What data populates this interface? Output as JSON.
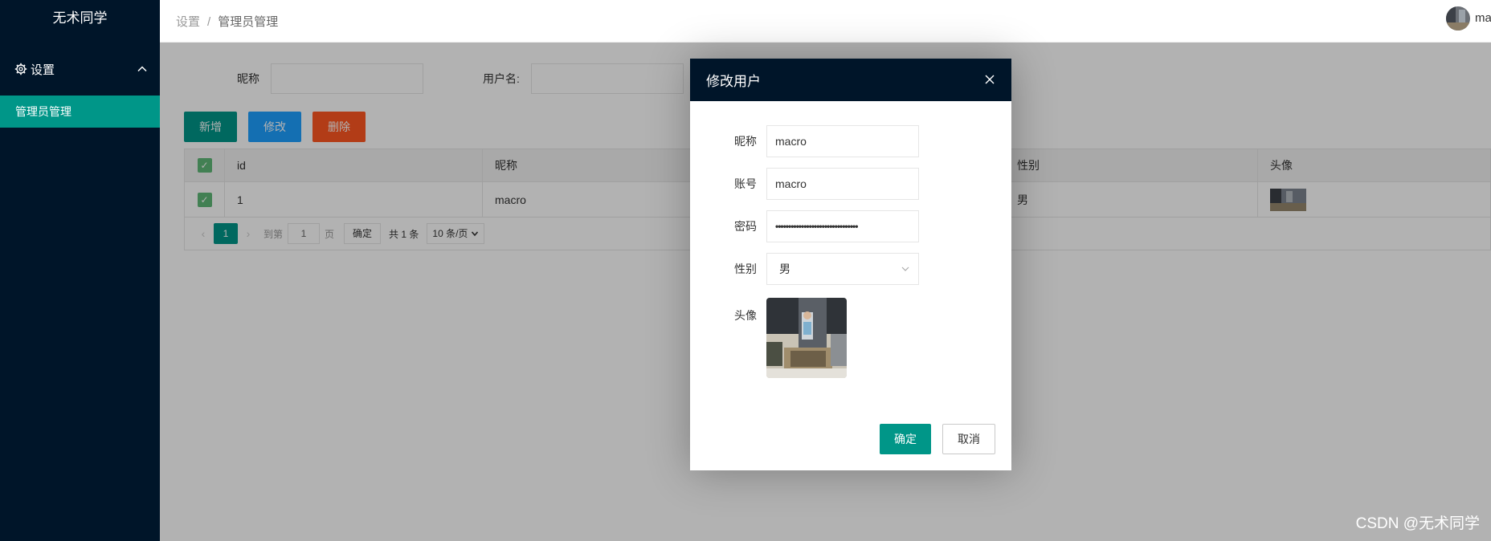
{
  "sidebar": {
    "brand": "无术同学",
    "group_label": "设置",
    "item_label": "管理员管理"
  },
  "header": {
    "crumb_root": "设置",
    "crumb_sep": "/",
    "crumb_current": "管理员管理",
    "user_name": "ma"
  },
  "search": {
    "nickname_label": "昵称",
    "username_label": "用户名:"
  },
  "toolbar": {
    "add_label": "新增",
    "edit_label": "修改",
    "delete_label": "删除"
  },
  "table": {
    "columns": [
      "id",
      "昵称",
      "性别",
      "头像"
    ],
    "rows": [
      {
        "id": "1",
        "nickname": "macro",
        "sex": "男"
      }
    ]
  },
  "pager": {
    "current_page": "1",
    "goto_label": "到第",
    "page_input": "1",
    "page_label": "页",
    "confirm_label": "确定",
    "total_label": "共 1 条",
    "page_size": "10 条/页"
  },
  "modal": {
    "title": "修改用户",
    "nickname_label": "昵称",
    "nickname_value": "macro",
    "account_label": "账号",
    "account_value": "macro",
    "password_label": "密码",
    "password_value": "••••••••••••••••••••••••••••••••",
    "sex_label": "性别",
    "sex_value": "男",
    "avatar_label": "头像",
    "ok_label": "确定",
    "cancel_label": "取消"
  },
  "watermark": "CSDN @无术同学",
  "colors": {
    "sidebar_bg": "#001529",
    "accent": "#009688",
    "blue": "#1E9FFF",
    "red": "#FF5722"
  }
}
